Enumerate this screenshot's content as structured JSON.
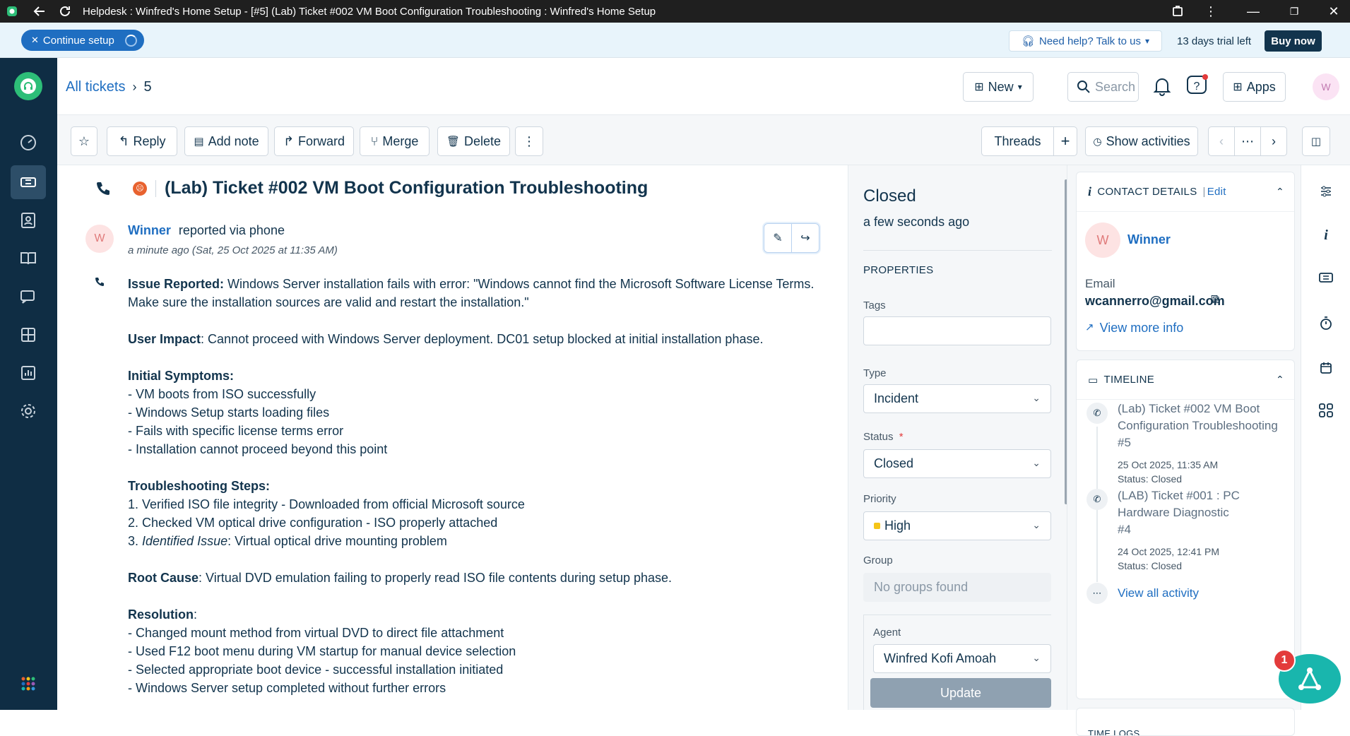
{
  "titlebar": {
    "title": "Helpdesk : Winfred's Home Setup - [#5] (Lab) Ticket #002 VM Boot Configuration Troubleshooting : Winfred's Home Setup"
  },
  "banner": {
    "continue_setup": "Continue setup",
    "help": "Need help? Talk to us",
    "trial": "13 days trial left",
    "buy_now": "Buy now"
  },
  "header": {
    "breadcrumb_root": "All tickets",
    "breadcrumb_current": "5",
    "new_label": "New",
    "search_placeholder": "Search",
    "apps_label": "Apps",
    "avatar_initial": "W"
  },
  "toolbar": {
    "reply": "Reply",
    "add_note": "Add note",
    "forward": "Forward",
    "merge": "Merge",
    "delete": "Delete",
    "threads": "Threads",
    "show_activities": "Show activities"
  },
  "ticket": {
    "subject": "(Lab) Ticket #002 VM Boot Configuration Troubleshooting",
    "requester": "Winner",
    "requester_initial": "W",
    "reported_via": "reported via phone",
    "time": "a minute ago (Sat, 25 Oct 2025 at 11:35 AM)",
    "body": [
      {
        "b": "Issue Reported:",
        "t": " Windows Server installation fails with error: \"Windows cannot find the Microsoft Software License Terms."
      },
      {
        "b": "",
        "t": "Make sure the installation sources are valid and restart the installation.\""
      },
      {
        "gap": true
      },
      {
        "b": "User Impact",
        "t": ": Cannot proceed with Windows Server deployment. DC01 setup blocked at initial installation phase."
      },
      {
        "gap": true
      },
      {
        "b": "Initial Symptoms:",
        "t": ""
      },
      {
        "b": "",
        "t": "- VM boots from ISO successfully"
      },
      {
        "b": "",
        "t": "- Windows Setup starts loading files"
      },
      {
        "b": "",
        "t": "- Fails with specific license terms error"
      },
      {
        "b": "",
        "t": "- Installation cannot proceed beyond this point"
      },
      {
        "gap": true
      },
      {
        "b": "Troubleshooting Steps:",
        "t": ""
      },
      {
        "b": "",
        "t": "1. Verified ISO file integrity - Downloaded from official Microsoft source"
      },
      {
        "b": "",
        "t": "2. Checked VM optical drive configuration - ISO properly attached"
      },
      {
        "b": "",
        "t": "3. ",
        "i": "Identified Issue",
        "t2": ": Virtual optical drive mounting problem"
      },
      {
        "gap": true
      },
      {
        "b": "Root Cause",
        "t": ": Virtual DVD emulation failing to properly read ISO file contents during setup phase."
      },
      {
        "gap": true
      },
      {
        "b": "Resolution",
        "t": ":"
      },
      {
        "b": "",
        "t": "- Changed mount method from virtual DVD to direct file attachment"
      },
      {
        "b": "",
        "t": "- Used F12 boot menu during VM startup for manual device selection"
      },
      {
        "b": "",
        "t": "- Selected appropriate boot device - successful installation initiated"
      },
      {
        "b": "",
        "t": "- Windows Server setup completed without further errors"
      }
    ]
  },
  "properties": {
    "status_title": "Closed",
    "status_time": "a few seconds ago",
    "heading": "PROPERTIES",
    "tags_label": "Tags",
    "type_label": "Type",
    "type_value": "Incident",
    "status_label": "Status",
    "required_mark": "*",
    "status_value": "Closed",
    "priority_label": "Priority",
    "priority_value": "High",
    "priority_color": "#f5c518",
    "group_label": "Group",
    "group_placeholder": "No groups found",
    "agent_label": "Agent",
    "agent_value": "Winfred Kofi Amoah",
    "update": "Update"
  },
  "contact": {
    "heading": "CONTACT DETAILS",
    "edit": "Edit",
    "name": "Winner",
    "initial": "W",
    "email_label": "Email",
    "email": "wcannerro@gmail.com",
    "view_more": "View more info"
  },
  "timeline": {
    "heading": "TIMELINE",
    "items": [
      {
        "title": "(Lab) Ticket #002 VM Boot Configuration Troubleshooting",
        "num": "#5",
        "date": "25 Oct 2025, 11:35 AM",
        "status": "Status: Closed"
      },
      {
        "title": "(LAB) Ticket #001 : PC Hardware Diagnostic",
        "num": "#4",
        "date": "24 Oct 2025, 12:41 PM",
        "status": "Status: Closed"
      }
    ],
    "view_all": "View all activity",
    "next_heading": "TIME LOGS"
  },
  "fab": {
    "badge": "1"
  }
}
